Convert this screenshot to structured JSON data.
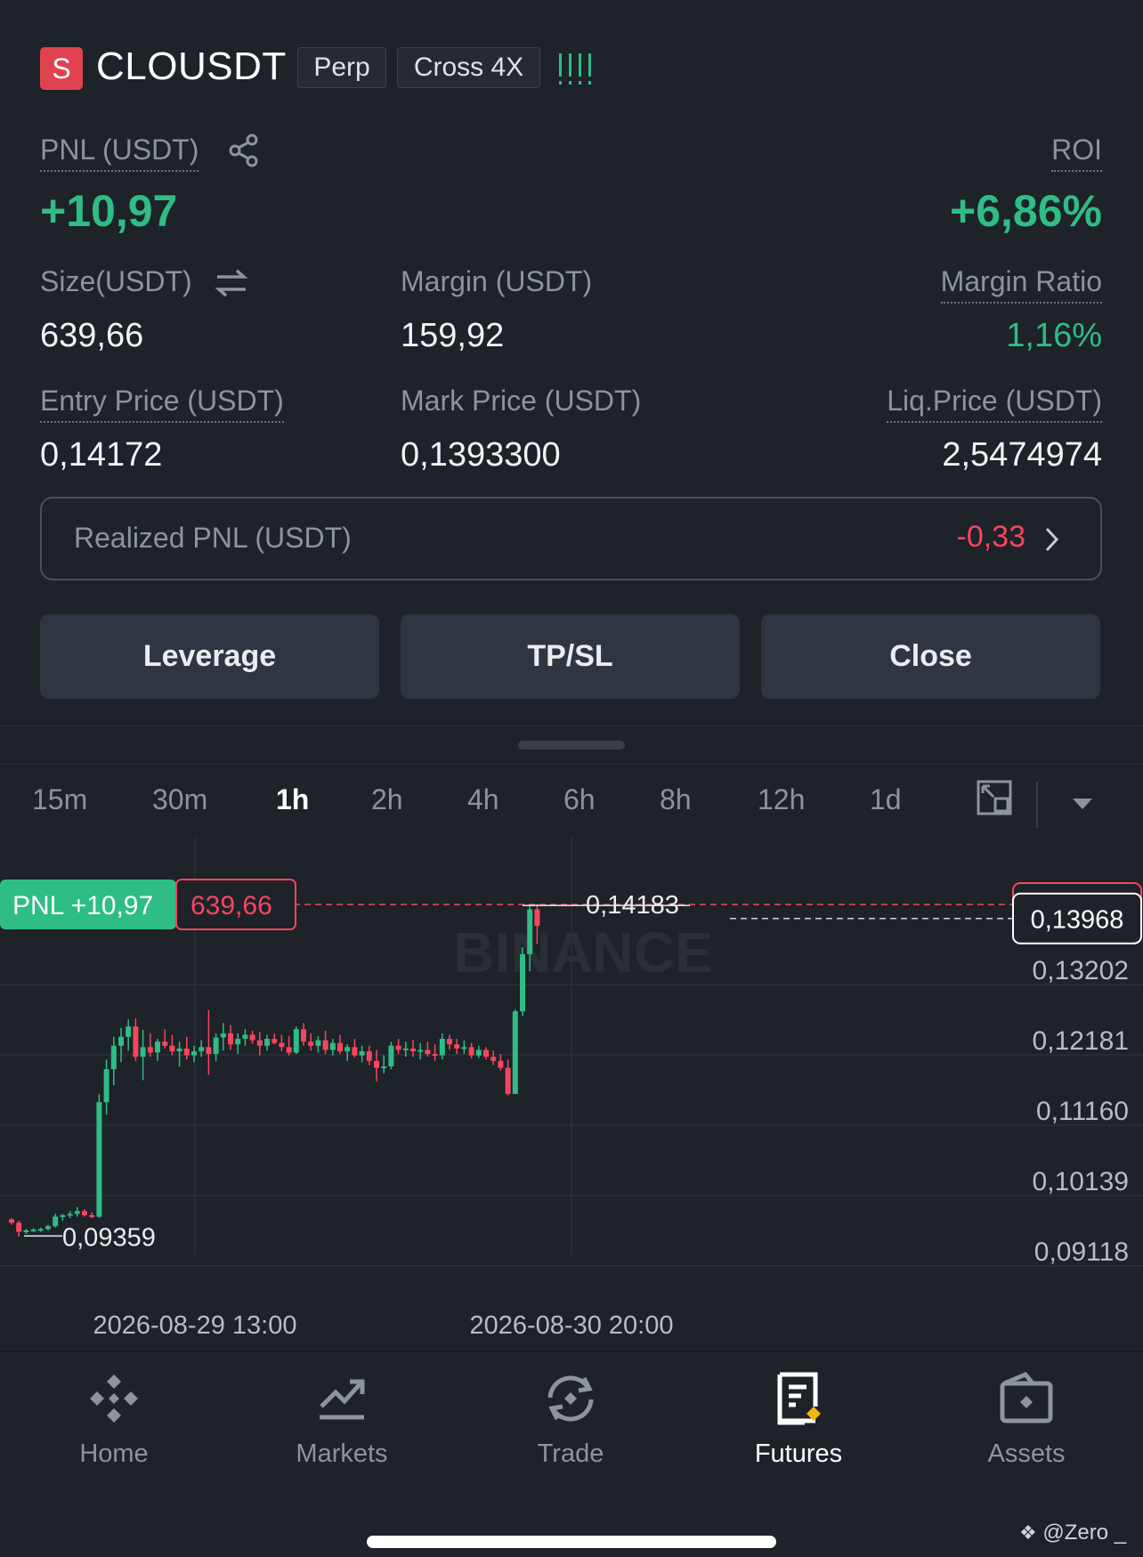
{
  "header": {
    "badge": "S",
    "symbol": "CLOUSDT",
    "tag_perp": "Perp",
    "tag_cross": "Cross 4X"
  },
  "pnl": {
    "label": "PNL (USDT)",
    "value": "+10,97",
    "roi_label": "ROI",
    "roi_value": "+6,86%"
  },
  "stats": {
    "size_label": "Size(USDT)",
    "size_value": "639,66",
    "margin_label": "Margin (USDT)",
    "margin_value": "159,92",
    "ratio_label": "Margin Ratio",
    "ratio_value": "1,16%",
    "entry_label": "Entry Price (USDT)",
    "entry_value": "0,14172",
    "mark_label": "Mark Price (USDT)",
    "mark_value": "0,1393300",
    "liq_label": "Liq.Price (USDT)",
    "liq_value": "2,5474974"
  },
  "realized": {
    "label": "Realized PNL (USDT)",
    "value": "-0,33"
  },
  "actions": {
    "leverage": "Leverage",
    "tpsl": "TP/SL",
    "close": "Close"
  },
  "timeframes": [
    "15m",
    "30m",
    "1h",
    "2h",
    "4h",
    "6h",
    "8h",
    "12h",
    "1d"
  ],
  "active_timeframe": "1h",
  "chart": {
    "pnl_tag": "PNL +10,97",
    "size_tag": "639,66",
    "high_label": "0,14183",
    "low_label": "0,09359",
    "current_price": "0,13968",
    "watermark": "BINANCE",
    "y_ticks": [
      "0,13202",
      "0,12181",
      "0,11160",
      "0,10139",
      "0,09118"
    ],
    "x_ticks": [
      "2026-08-29 13:00",
      "2026-08-30 20:00"
    ],
    "colors": {
      "up": "#2ebd85",
      "down": "#f6465d"
    }
  },
  "chart_data": {
    "type": "candlestick",
    "x_ticks": [
      "2026-08-29 13:00",
      "2026-08-30 20:00"
    ],
    "y_ticks": [
      0.13202,
      0.12181,
      0.1116,
      0.10139,
      0.09118
    ],
    "ylim": [
      0.0901,
      0.1435
    ],
    "entry_price": 0.14172,
    "current_price": 0.13968,
    "high": 0.14183,
    "low": 0.09359,
    "ohlc": [
      [
        0.096,
        0.0962,
        0.0952,
        0.0955
      ],
      [
        0.0955,
        0.0958,
        0.0935,
        0.0942
      ],
      [
        0.0942,
        0.0946,
        0.0939,
        0.0944
      ],
      [
        0.0944,
        0.0947,
        0.0942,
        0.0945
      ],
      [
        0.0945,
        0.0948,
        0.0942,
        0.0946
      ],
      [
        0.0946,
        0.0952,
        0.0944,
        0.095
      ],
      [
        0.095,
        0.0968,
        0.0948,
        0.0964
      ],
      [
        0.0964,
        0.0968,
        0.0958,
        0.0966
      ],
      [
        0.0966,
        0.0972,
        0.0962,
        0.0968
      ],
      [
        0.0968,
        0.0978,
        0.0964,
        0.0972
      ],
      [
        0.0972,
        0.0975,
        0.0964,
        0.0966
      ],
      [
        0.0966,
        0.097,
        0.0962,
        0.0964
      ],
      [
        0.0964,
        0.1142,
        0.0962,
        0.113
      ],
      [
        0.113,
        0.1192,
        0.1112,
        0.1178
      ],
      [
        0.1178,
        0.1225,
        0.1155,
        0.1212
      ],
      [
        0.1212,
        0.1238,
        0.1188,
        0.1225
      ],
      [
        0.1225,
        0.125,
        0.1205,
        0.124
      ],
      [
        0.124,
        0.1252,
        0.119,
        0.1196
      ],
      [
        0.1196,
        0.1235,
        0.1162,
        0.121
      ],
      [
        0.121,
        0.123,
        0.1196,
        0.1202
      ],
      [
        0.1202,
        0.1222,
        0.119,
        0.1218
      ],
      [
        0.1218,
        0.1236,
        0.1208,
        0.1212
      ],
      [
        0.1212,
        0.1228,
        0.1198,
        0.1204
      ],
      [
        0.1204,
        0.1218,
        0.1182,
        0.1208
      ],
      [
        0.1208,
        0.1225,
        0.1192,
        0.1198
      ],
      [
        0.1198,
        0.1212,
        0.1188,
        0.1204
      ],
      [
        0.1204,
        0.122,
        0.1196,
        0.121
      ],
      [
        0.121,
        0.1264,
        0.117,
        0.12
      ],
      [
        0.12,
        0.123,
        0.119,
        0.1224
      ],
      [
        0.1224,
        0.1245,
        0.1205,
        0.123
      ],
      [
        0.123,
        0.1242,
        0.1206,
        0.1214
      ],
      [
        0.1214,
        0.123,
        0.12,
        0.1222
      ],
      [
        0.1222,
        0.1236,
        0.1212,
        0.1228
      ],
      [
        0.1228,
        0.1234,
        0.1215,
        0.122
      ],
      [
        0.122,
        0.1232,
        0.1198,
        0.1212
      ],
      [
        0.1212,
        0.1228,
        0.1205,
        0.1222
      ],
      [
        0.1222,
        0.123,
        0.1214,
        0.1216
      ],
      [
        0.1216,
        0.1228,
        0.1204,
        0.121
      ],
      [
        0.121,
        0.1226,
        0.1198,
        0.1202
      ],
      [
        0.1202,
        0.124,
        0.12,
        0.1236
      ],
      [
        0.1236,
        0.1245,
        0.1212,
        0.1218
      ],
      [
        0.1218,
        0.123,
        0.1205,
        0.1212
      ],
      [
        0.1212,
        0.1226,
        0.1202,
        0.122
      ],
      [
        0.122,
        0.1234,
        0.12,
        0.1206
      ],
      [
        0.1206,
        0.1222,
        0.1198,
        0.1216
      ],
      [
        0.1216,
        0.1228,
        0.12,
        0.1204
      ],
      [
        0.1204,
        0.1214,
        0.119,
        0.121
      ],
      [
        0.121,
        0.1222,
        0.1195,
        0.1198
      ],
      [
        0.1198,
        0.1212,
        0.1188,
        0.1204
      ],
      [
        0.1204,
        0.1212,
        0.1184,
        0.119
      ],
      [
        0.119,
        0.1206,
        0.116,
        0.118
      ],
      [
        0.118,
        0.1198,
        0.1172,
        0.1182
      ],
      [
        0.1182,
        0.1218,
        0.1178,
        0.1212
      ],
      [
        0.1212,
        0.1222,
        0.12,
        0.1206
      ],
      [
        0.1206,
        0.1218,
        0.1196,
        0.1208
      ],
      [
        0.1208,
        0.122,
        0.1196,
        0.1204
      ],
      [
        0.1204,
        0.1216,
        0.1192,
        0.1206
      ],
      [
        0.1206,
        0.1218,
        0.1196,
        0.12
      ],
      [
        0.12,
        0.1214,
        0.119,
        0.1198
      ],
      [
        0.1198,
        0.123,
        0.1192,
        0.1222
      ],
      [
        0.1222,
        0.1228,
        0.1206,
        0.1214
      ],
      [
        0.1214,
        0.1222,
        0.12,
        0.1208
      ],
      [
        0.1208,
        0.122,
        0.12,
        0.121
      ],
      [
        0.121,
        0.1216,
        0.1194,
        0.1198
      ],
      [
        0.1198,
        0.1212,
        0.1194,
        0.1206
      ],
      [
        0.1206,
        0.121,
        0.1192,
        0.1196
      ],
      [
        0.1196,
        0.1205,
        0.1184,
        0.119
      ],
      [
        0.119,
        0.12,
        0.1176,
        0.118
      ],
      [
        0.118,
        0.1192,
        0.114,
        0.1142
      ],
      [
        0.1142,
        0.1265,
        0.1142,
        0.1262
      ],
      [
        0.1262,
        0.1355,
        0.1255,
        0.1345
      ],
      [
        0.1345,
        0.1418,
        0.132,
        0.141
      ],
      [
        0.141,
        0.1418,
        0.136,
        0.1386
      ]
    ]
  },
  "nav": {
    "items": [
      {
        "label": "Home",
        "icon": "binance-logo-icon"
      },
      {
        "label": "Markets",
        "icon": "chart-trend-icon"
      },
      {
        "label": "Trade",
        "icon": "trade-swap-icon"
      },
      {
        "label": "Futures",
        "icon": "futures-doc-icon"
      },
      {
        "label": "Assets",
        "icon": "wallet-icon"
      }
    ],
    "active": "Futures"
  },
  "watermark_text": "@Zero _"
}
